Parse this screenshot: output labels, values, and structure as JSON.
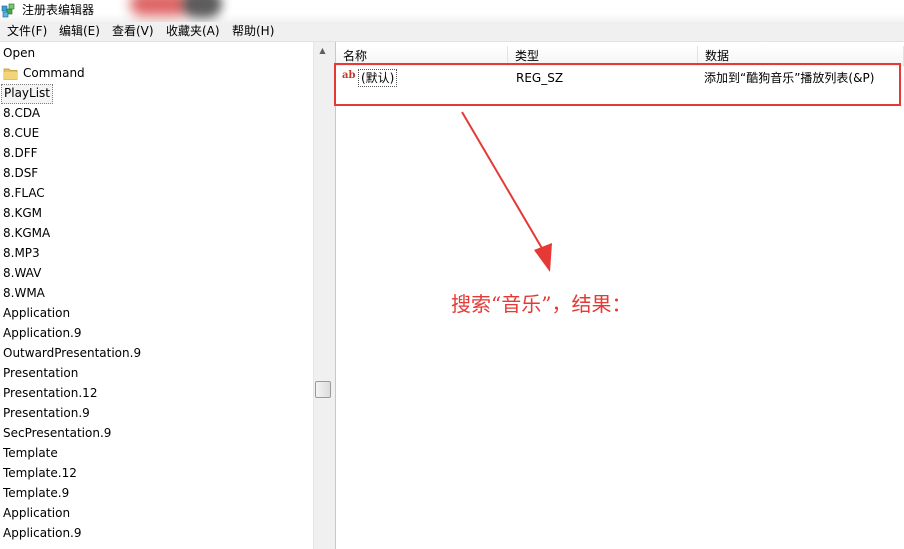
{
  "window": {
    "title": "注册表编辑器"
  },
  "menu": [
    "文件(F)",
    "编辑(E)",
    "查看(V)",
    "收藏夹(A)",
    "帮助(H)"
  ],
  "tree": {
    "items": [
      "Open",
      "Command",
      "PlayList",
      "8.CDA",
      "8.CUE",
      "8.DFF",
      "8.DSF",
      "8.FLAC",
      "8.KGM",
      "8.KGMA",
      "8.MP3",
      "8.WAV",
      "8.WMA",
      "Application",
      "Application.9",
      "OutwardPresentation.9",
      "Presentation",
      "Presentation.12",
      "Presentation.9",
      "SecPresentation.9",
      "Template",
      "Template.12",
      "Template.9",
      "Application",
      "Application.9"
    ],
    "folder_item_index": 1,
    "selected_index": 2
  },
  "list": {
    "columns": [
      "名称",
      "类型",
      "数据"
    ],
    "rows": [
      {
        "name": "(默认)",
        "type": "REG_SZ",
        "data": "添加到“酷狗音乐”播放列表(&P)",
        "icon": "ab-string-icon"
      }
    ]
  },
  "annotation": {
    "text": "搜索“音乐”，结果：",
    "color": "#e53935"
  },
  "colors": {
    "highlight": "#e53935",
    "icon_red": "#c0392b",
    "folder": "#e8c25a"
  }
}
